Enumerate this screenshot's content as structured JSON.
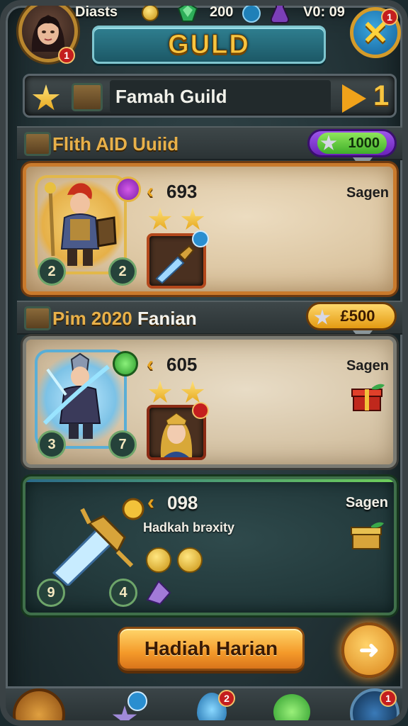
{
  "topbar": {
    "player_name": "Diasts",
    "avatar_badge": "1",
    "currency_value": "200",
    "timer": "V0: 09",
    "close_badge": "1"
  },
  "title": "GULD",
  "guild_row": {
    "guild_name": "Famah Guild",
    "rank": "1"
  },
  "sections": [
    {
      "header": "Flith AID Uuiid",
      "header_extra": "",
      "pill_value": "1000",
      "pill_color": "#7a2cc8",
      "card": {
        "value": "693",
        "tag": "Sagen",
        "level_left": "2",
        "level_right": "2",
        "stars": 2
      }
    },
    {
      "header": "Pim 2020",
      "header_extra": "Fanian",
      "pill_value": "£500",
      "pill_color": "#e39a12",
      "card": {
        "value": "605",
        "tag": "Sagen",
        "level_left": "3",
        "level_right": "7",
        "stars": 2
      }
    },
    {
      "card": {
        "value": "098",
        "subtitle": "Hadkah brəxity",
        "tag": "Sagen",
        "level_left": "9",
        "level_right": "4"
      }
    }
  ],
  "cta_label": "Hadiah Harian",
  "nav": {
    "badge_1": "2",
    "badge_2": "1"
  },
  "colors": {
    "accent_gold": "#f7c540",
    "card_border_orange": "#c97a2c",
    "card_border_green": "#3f6f4a"
  }
}
